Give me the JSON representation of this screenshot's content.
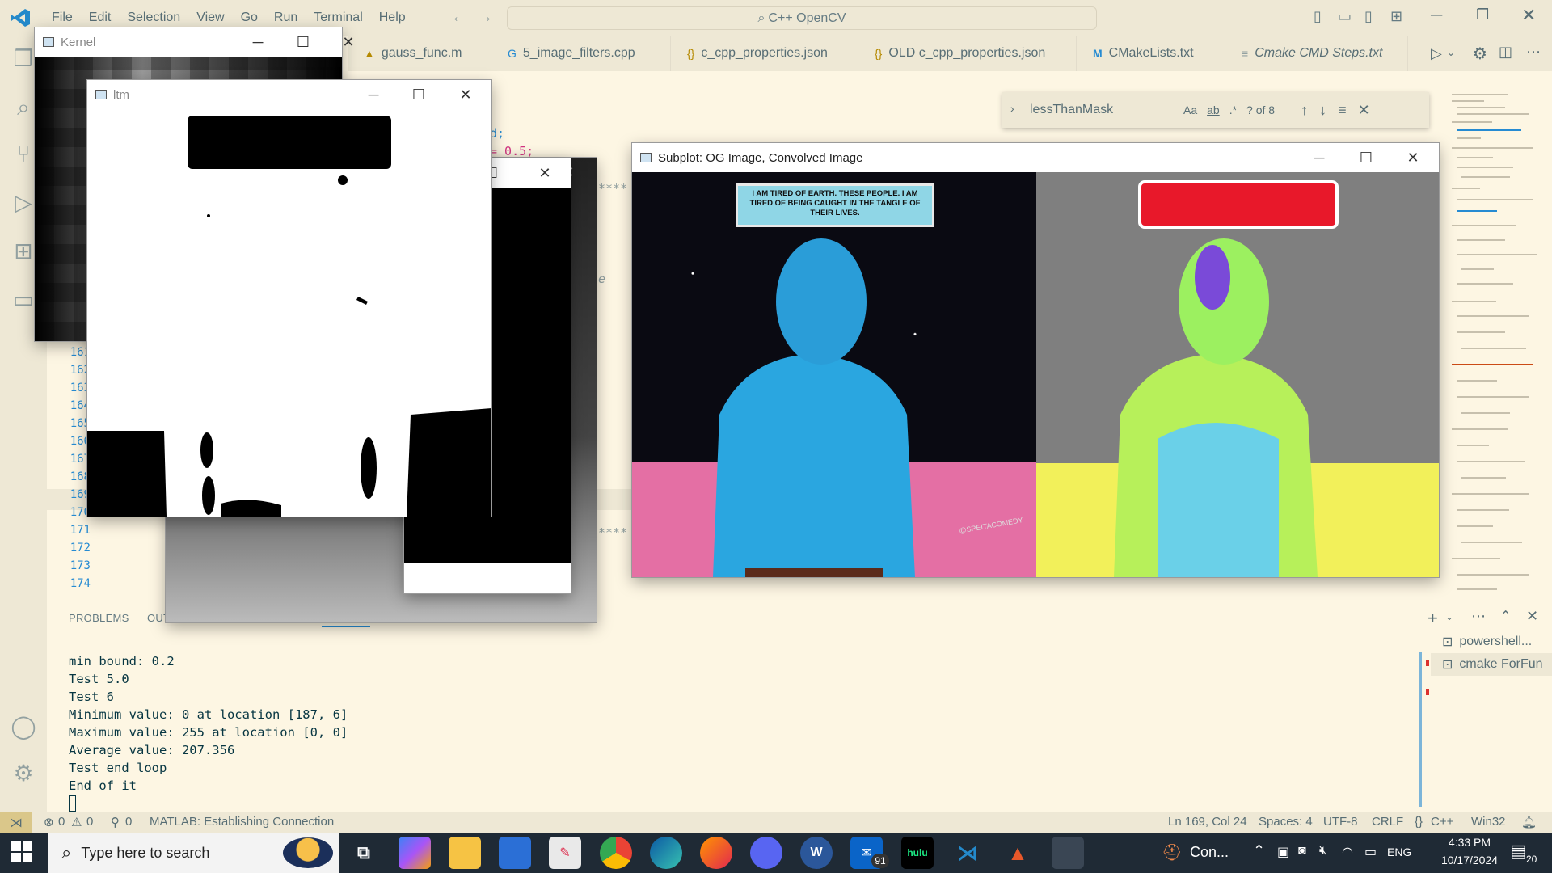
{
  "menu": [
    "File",
    "Edit",
    "Selection",
    "View",
    "Go",
    "Run",
    "Terminal",
    "Help"
  ],
  "command_center": "C++ OpenCV",
  "tabs": [
    {
      "label": "gauss_func.m",
      "icon": "matlab-file-icon"
    },
    {
      "label": "5_image_filters.cpp",
      "icon": "cpp-file-icon"
    },
    {
      "label": "c_cpp_properties.json",
      "icon": "json-file-icon"
    },
    {
      "label": "OLD c_cpp_properties.json",
      "icon": "json-file-icon"
    },
    {
      "label": "CMakeLists.txt",
      "icon": "cmake-file-icon"
    },
    {
      "label": "Cmake CMD Steps.txt",
      "icon": "text-file-icon"
    }
  ],
  "editor": {
    "line_numbers": [
      "161",
      "162",
      "163",
      "164",
      "165",
      "166",
      "167",
      "168",
      "169",
      "170",
      "171",
      "172",
      "173",
      "174"
    ],
    "snippet_1": "d;",
    "snippet_2": "= 0.5;",
    "comment_mark": "****",
    "italic_e": "e"
  },
  "find_widget": {
    "query": "lessThanMask",
    "match_case": "Aa",
    "whole_word": "ab",
    "regex": ".*",
    "result": "? of 8"
  },
  "panel_tabs": [
    "PROBLEMS",
    "OUTPUT"
  ],
  "terminal_lines": [
    "min_bound: 0.2",
    "Test 5.0",
    "Test 6",
    "Minimum value: 0 at location [187, 6]",
    "Maximum value: 255 at location [0, 0]",
    "Average value: 207.356",
    "Test end loop",
    "End of it"
  ],
  "terminal_list": [
    "powershell...",
    "cmake  ForFun"
  ],
  "status": {
    "errors": "0",
    "warnings": "0",
    "ports": "0",
    "matlab": "MATLAB: Establishing Connection",
    "position": "Ln 169, Col 24",
    "spaces": "Spaces: 4",
    "encoding": "UTF-8",
    "eol": "CRLF",
    "language": "C++",
    "platform": "Win32"
  },
  "windows": {
    "kernel": "Kernel",
    "ltm": "ltm",
    "subplot": "Subplot: OG Image, Convolved Image"
  },
  "comic_caption": "I AM TIRED OF EARTH. THESE PEOPLE. I AM TIRED OF BEING CAUGHT IN THE TANGLE OF THEIR LIVES.",
  "comic_watermark": "@SPEITACOMEDY",
  "taskbar": {
    "search_placeholder": "Type here to search",
    "running_app": "Con...",
    "mail_badge": "91",
    "hulu": "hulu",
    "lang": "ENG",
    "time": "4:33 PM",
    "date": "10/17/2024",
    "notif_count": "20"
  },
  "colors": {
    "accent": "#268bd2",
    "bg": "#fdf6e3",
    "chrome": "#eee8d5"
  }
}
